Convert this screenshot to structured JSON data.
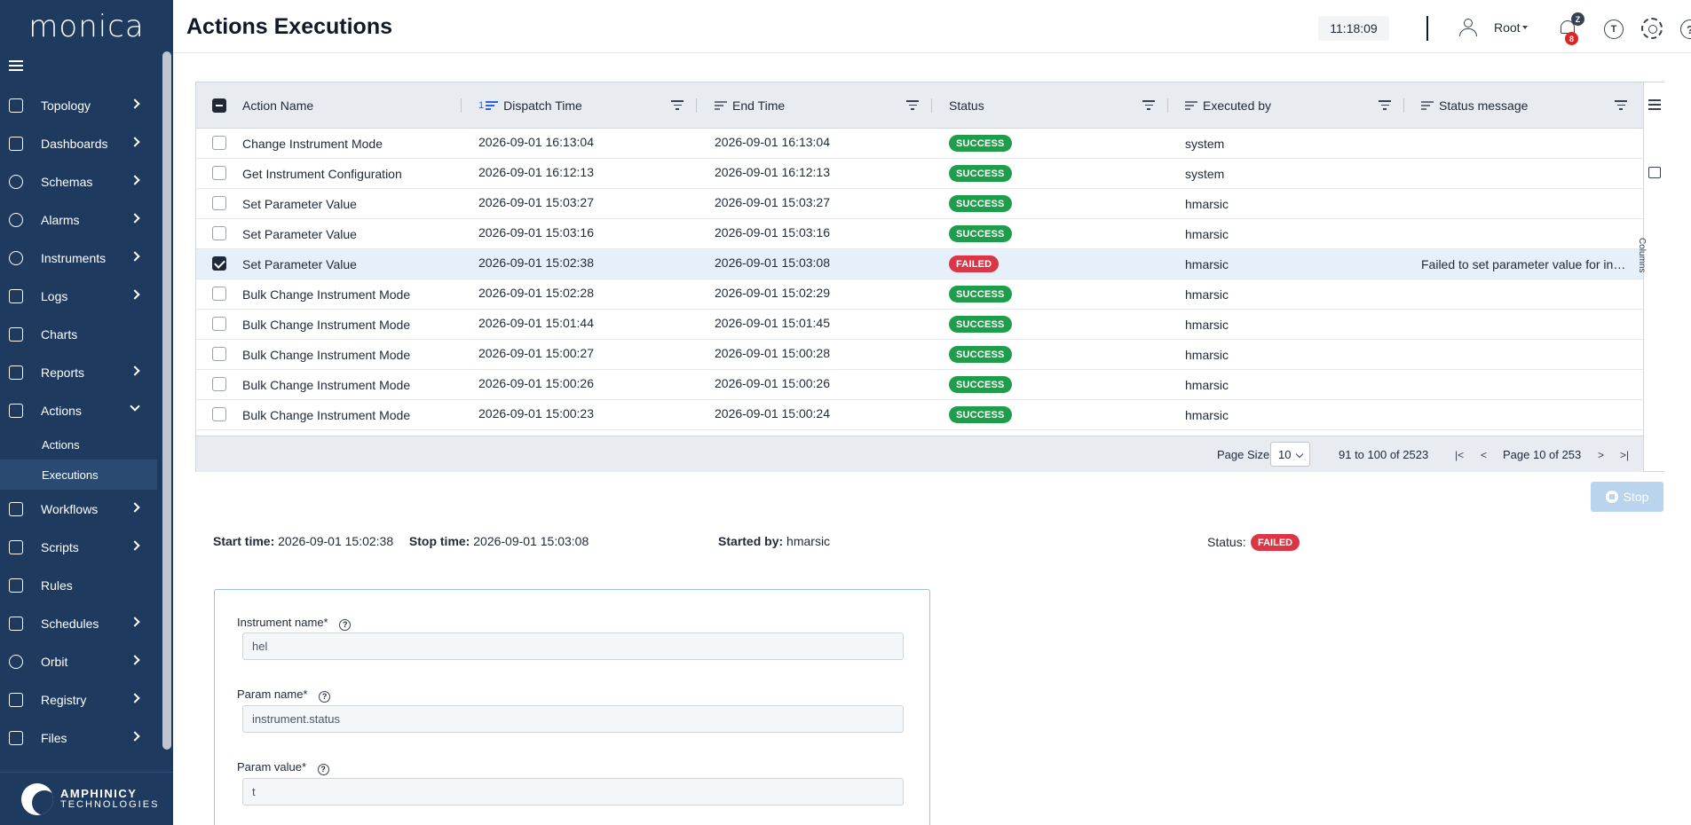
{
  "app": {
    "logo": "monica",
    "company": [
      "AMPHINICY",
      "TECHNOLOGIES"
    ]
  },
  "header": {
    "title": "Actions Executions",
    "time": "11:18:09",
    "user": "Root",
    "badge_z": "Z",
    "badge_count": "8",
    "t_label": "T",
    "help_label": "?"
  },
  "sidebar": {
    "items": [
      {
        "label": "Topology",
        "icon": "topology-icon",
        "chevron": true
      },
      {
        "label": "Dashboards",
        "icon": "dashboards-icon",
        "chevron": true
      },
      {
        "label": "Schemas",
        "icon": "schemas-icon",
        "chevron": true
      },
      {
        "label": "Alarms",
        "icon": "bell-icon",
        "chevron": true
      },
      {
        "label": "Instruments",
        "icon": "instruments-icon",
        "chevron": true
      },
      {
        "label": "Logs",
        "icon": "logs-icon",
        "chevron": true
      },
      {
        "label": "Charts",
        "icon": "charts-icon",
        "chevron": false
      },
      {
        "label": "Reports",
        "icon": "reports-icon",
        "chevron": true
      },
      {
        "label": "Actions",
        "icon": "calendar-icon",
        "chevron": true,
        "expanded": true
      }
    ],
    "sub_items": [
      {
        "label": "Actions",
        "active": false
      },
      {
        "label": "Executions",
        "active": true
      }
    ],
    "items_after": [
      {
        "label": "Workflows",
        "icon": "workflows-icon",
        "chevron": true
      },
      {
        "label": "Scripts",
        "icon": "scripts-icon",
        "chevron": true
      },
      {
        "label": "Rules",
        "icon": "rules-icon",
        "chevron": false
      },
      {
        "label": "Schedules",
        "icon": "schedules-icon",
        "chevron": true
      },
      {
        "label": "Orbit",
        "icon": "orbit-icon",
        "chevron": true
      },
      {
        "label": "Registry",
        "icon": "registry-icon",
        "chevron": true
      },
      {
        "label": "Files",
        "icon": "files-icon",
        "chevron": true
      }
    ]
  },
  "grid": {
    "columns": {
      "action_name": "Action Name",
      "dispatch_sort": "1",
      "dispatch_time": "Dispatch Time",
      "end_time": "End Time",
      "status": "Status",
      "executed_by": "Executed by",
      "status_message": "Status message"
    },
    "side_tab": "Columns",
    "rows": [
      {
        "name": "Change Instrument Mode",
        "dispatch": "2026-09-01 16:13:04",
        "end": "2026-09-01 16:13:04",
        "status": "SUCCESS",
        "by": "system",
        "message": "",
        "selected": false
      },
      {
        "name": "Get Instrument Configuration",
        "dispatch": "2026-09-01 16:12:13",
        "end": "2026-09-01 16:12:13",
        "status": "SUCCESS",
        "by": "system",
        "message": "",
        "selected": false
      },
      {
        "name": "Set Parameter Value",
        "dispatch": "2026-09-01 15:03:27",
        "end": "2026-09-01 15:03:27",
        "status": "SUCCESS",
        "by": "hmarsic",
        "message": "",
        "selected": false
      },
      {
        "name": "Set Parameter Value",
        "dispatch": "2026-09-01 15:03:16",
        "end": "2026-09-01 15:03:16",
        "status": "SUCCESS",
        "by": "hmarsic",
        "message": "",
        "selected": false
      },
      {
        "name": "Set Parameter Value",
        "dispatch": "2026-09-01 15:02:38",
        "end": "2026-09-01 15:03:08",
        "status": "FAILED",
        "by": "hmarsic",
        "message": "Failed to set parameter value for in…",
        "selected": true
      },
      {
        "name": "Bulk Change Instrument Mode",
        "dispatch": "2026-09-01 15:02:28",
        "end": "2026-09-01 15:02:29",
        "status": "SUCCESS",
        "by": "hmarsic",
        "message": "",
        "selected": false
      },
      {
        "name": "Bulk Change Instrument Mode",
        "dispatch": "2026-09-01 15:01:44",
        "end": "2026-09-01 15:01:45",
        "status": "SUCCESS",
        "by": "hmarsic",
        "message": "",
        "selected": false
      },
      {
        "name": "Bulk Change Instrument Mode",
        "dispatch": "2026-09-01 15:00:27",
        "end": "2026-09-01 15:00:28",
        "status": "SUCCESS",
        "by": "hmarsic",
        "message": "",
        "selected": false
      },
      {
        "name": "Bulk Change Instrument Mode",
        "dispatch": "2026-09-01 15:00:26",
        "end": "2026-09-01 15:00:26",
        "status": "SUCCESS",
        "by": "hmarsic",
        "message": "",
        "selected": false
      },
      {
        "name": "Bulk Change Instrument Mode",
        "dispatch": "2026-09-01 15:00:23",
        "end": "2026-09-01 15:00:24",
        "status": "SUCCESS",
        "by": "hmarsic",
        "message": "",
        "selected": false
      }
    ],
    "footer": {
      "page_size_label": "Page Size:",
      "page_size": "10",
      "range": "91 to 100 of 2523",
      "first": "|<",
      "prev": "<",
      "page_text": "Page 10 of 253",
      "next": ">",
      "last": ">|"
    }
  },
  "stop_button": {
    "label": "Stop"
  },
  "execution": {
    "start_label": "Start time:",
    "start": "2026-09-01 15:02:38",
    "stop_label": "Stop time:",
    "stop": "2026-09-01 15:03:08",
    "started_by_label": "Started by:",
    "started_by": "hmarsic",
    "status_label": "Status:",
    "status": "FAILED"
  },
  "form": {
    "instrument_label": "Instrument name",
    "instrument_value": "hel",
    "param_label": "Param name",
    "param_value": "instrument.status",
    "value_label": "Param value",
    "value_value": "t",
    "required_mark": "*",
    "help_mark": "?"
  },
  "colors": {
    "sidebar": "#1e3a5f",
    "success": "#1e9e4a",
    "failed": "#dc3545",
    "accent": "#2563eb"
  }
}
